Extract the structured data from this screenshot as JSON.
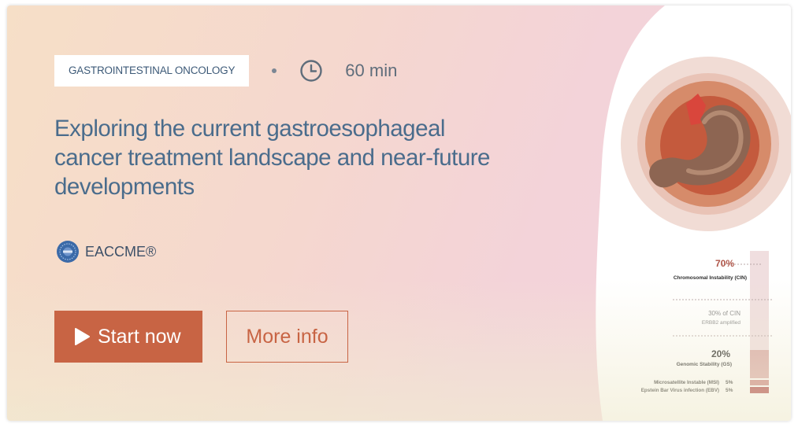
{
  "course": {
    "category": "GASTROINTESTINAL ONCOLOGY",
    "duration": "60 min",
    "title": "Exploring the current gastroesophageal cancer treatment landscape and near-future developments",
    "accreditation": "EACCME®"
  },
  "actions": {
    "start_label": "Start now",
    "more_label": "More info"
  },
  "illustration": {
    "subtypes": [
      {
        "percent": "70%",
        "label": "Chromosomal Instability (CIN)"
      },
      {
        "percent": "",
        "label": "30% of CIN"
      },
      {
        "percent": "",
        "label": "ERBB2 amplified"
      },
      {
        "percent": "20%",
        "label": "Genomic Stability (GS)"
      },
      {
        "percent": "5%",
        "label": "Microsatellite Instable (MSI)"
      },
      {
        "percent": "5%",
        "label": "Epstein Bar Virus infection (EBV)"
      }
    ]
  },
  "colors": {
    "accent": "#c86444",
    "title": "#4a6c8c"
  },
  "icons": [
    "clock-icon",
    "eaccme-logo",
    "play-icon",
    "stomach-illustration"
  ]
}
